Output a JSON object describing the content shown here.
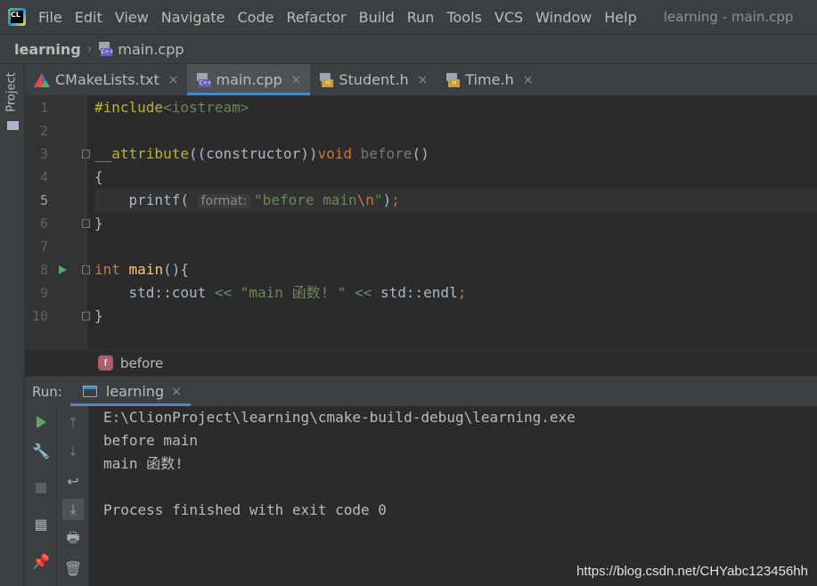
{
  "menubar": {
    "logo_text": "CL",
    "items": [
      "File",
      "Edit",
      "View",
      "Navigate",
      "Code",
      "Refactor",
      "Build",
      "Run",
      "Tools",
      "VCS",
      "Window",
      "Help"
    ],
    "window_title": "learning - main.cpp"
  },
  "navbar": {
    "project": "learning",
    "file": "main.cpp",
    "file_icon_label": "C++"
  },
  "left_strip": {
    "project_label": "Project"
  },
  "tabs": [
    {
      "label": "CMakeLists.txt",
      "icon": "cmake-icon",
      "active": false
    },
    {
      "label": "main.cpp",
      "icon": "cpp-file-icon",
      "icon_label": "C++",
      "active": true
    },
    {
      "label": "Student.h",
      "icon": "header-file-icon",
      "icon_label": "H",
      "active": false
    },
    {
      "label": "Time.h",
      "icon": "header-file-icon",
      "icon_label": "H",
      "active": false
    }
  ],
  "tab_close": "×",
  "editor": {
    "current_line": 5,
    "line_numbers": [
      "1",
      "2",
      "3",
      "4",
      "5",
      "6",
      "7",
      "8",
      "9",
      "10"
    ],
    "code": {
      "l1_directive": "#include",
      "l1_header": "<iostream>",
      "l3_attr": "__attribute",
      "l3_paren_open": "((",
      "l3_constructor": "constructor",
      "l3_paren_close": "))",
      "l3_void": "void",
      "l3_name": "before",
      "l3_tail": "()",
      "l4": "{",
      "l5_indent": "    ",
      "l5_call": "printf(",
      "l5_hint": "format:",
      "l5_string": "\"before main",
      "l5_escape": "\\n",
      "l5_string_end": "\"",
      "l5_tail": ")",
      "l5_semi": ";",
      "l6": "}",
      "l8_int": "int",
      "l8_main": " main",
      "l8_tail": "(){",
      "l9_indent": "    ",
      "l9_cout": "std::cout",
      "l9_op1": " << ",
      "l9_string": "\"main 函数! \"",
      "l9_op2": " << ",
      "l9_endl": "std::endl",
      "l9_semi": ";",
      "l10": "}"
    }
  },
  "breadcrumb": {
    "func_icon": "f",
    "func_name": "before"
  },
  "run_panel": {
    "label": "Run:",
    "tab_label": "learning",
    "tab_close": "×",
    "tools_left": [
      "rerun-icon",
      "wrench-icon",
      "stop-icon",
      "layout-icon",
      "pin-icon"
    ],
    "tools_right": [
      "arrow-up-icon",
      "arrow-down-icon",
      "soft-wrap-icon",
      "scroll-to-end-icon",
      "print-icon",
      "trash-icon"
    ],
    "glyphs": {
      "wrench": "🔧",
      "layout": "▦",
      "pin": "📌",
      "up": "↑",
      "down": "↓",
      "wrap": "↩",
      "scroll_end": "⤓",
      "print": "🖶",
      "trash": "🗑"
    }
  },
  "console": {
    "lines": [
      "E:\\ClionProject\\learning\\cmake-build-debug\\learning.exe",
      "before main",
      "main 函数!",
      "",
      "Process finished with exit code 0"
    ]
  },
  "watermark": "https://blog.csdn.net/CHYabc123456hh",
  "colors": {
    "keyword": "#cc7832",
    "string": "#6a8759",
    "preprocessor": "#bbb529",
    "accent": "#4a88c7",
    "run_green": "#59a869"
  }
}
